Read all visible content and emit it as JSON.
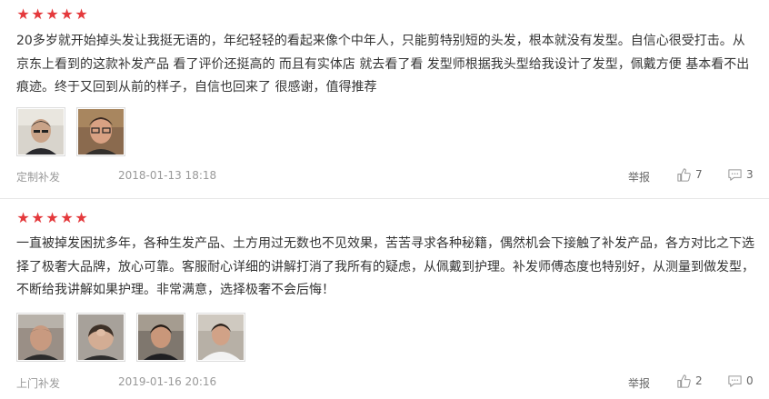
{
  "reviews": [
    {
      "rating": 5,
      "text": "20多岁就开始掉头发让我挺无语的，年纪轻轻的看起来像个中年人，只能剪特别短的头发，根本就没有发型。自信心很受打击。从京东上看到的这款补发产品 看了评价还挺高的 而且有实体店 就去看了看 发型师根据我头型给我设计了发型，佩戴方便 基本看不出痕迹。终于又回到从前的样子，自信也回来了 很感谢，值得推荐",
      "photos": [
        "photo-balding-man",
        "photo-man-with-glasses"
      ],
      "tag": "定制补发",
      "date": "2018-01-13 18:18",
      "report_label": "举报",
      "likes": "7",
      "comments": "3"
    },
    {
      "rating": 5,
      "text": "一直被掉发困扰多年，各种生发产品、土方用过无数也不见效果，苦苦寻求各种秘籍，偶然机会下接触了补发产品，各方对比之下选择了极奢大品牌，放心可靠。客服耐心详细的讲解打消了我所有的疑虑，从佩戴到护理。补发师傅态度也特别好，从测量到做发型，不断给我讲解如果护理。非常满意，选择极奢不会后悔！",
      "photos": [
        "photo-scalp-front",
        "photo-scalp-top",
        "photo-man-result",
        "photo-man-white-shirt"
      ],
      "tag": "上门补发",
      "date": "2019-01-16 20:16",
      "report_label": "举报",
      "likes": "2",
      "comments": "0"
    }
  ],
  "colors": {
    "star": "#e4393c",
    "meta": "#999999",
    "text": "#333333"
  },
  "icons": {
    "star": "star-icon",
    "like": "thumbs-up-icon",
    "comment": "comment-bubble-icon"
  }
}
